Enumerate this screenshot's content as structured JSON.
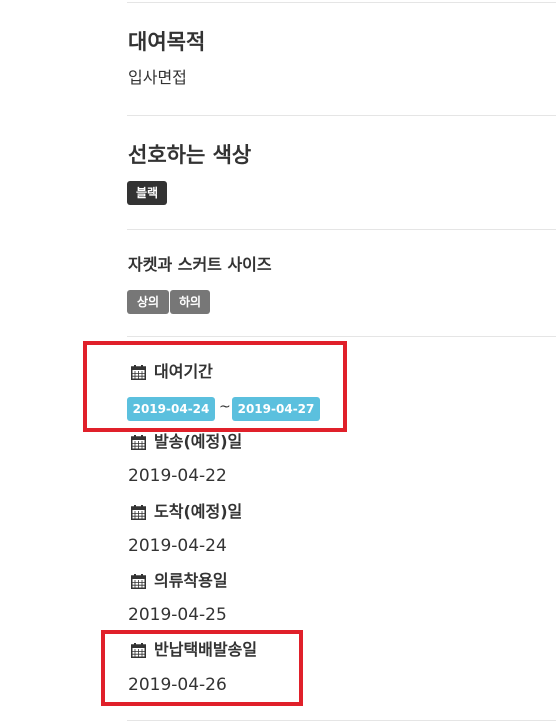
{
  "purpose": {
    "heading": "대여목적",
    "value": "입사면접"
  },
  "color_pref": {
    "heading": "선호하는 색상",
    "tag": "블랙"
  },
  "size": {
    "heading": "자켓과 스커트 사이즈",
    "tags": [
      "상의",
      "하의"
    ]
  },
  "rental_period": {
    "label": "대여기간",
    "start": "2019-04-24",
    "separator": "~",
    "end": "2019-04-27"
  },
  "shipping": {
    "label": "발송(예정)일",
    "date": "2019-04-22"
  },
  "arrival": {
    "label": "도착(예정)일",
    "date": "2019-04-24"
  },
  "wear_date": {
    "label": "의류착용일",
    "date": "2019-04-25"
  },
  "return_date": {
    "label": "반납택배발송일",
    "date": "2019-04-26"
  },
  "icons": {
    "calendar": "calendar-icon"
  },
  "colors": {
    "highlight_border": "#e0202a",
    "info_badge": "#5bc0de",
    "dark_badge": "#333333",
    "gray_badge": "#777777"
  }
}
